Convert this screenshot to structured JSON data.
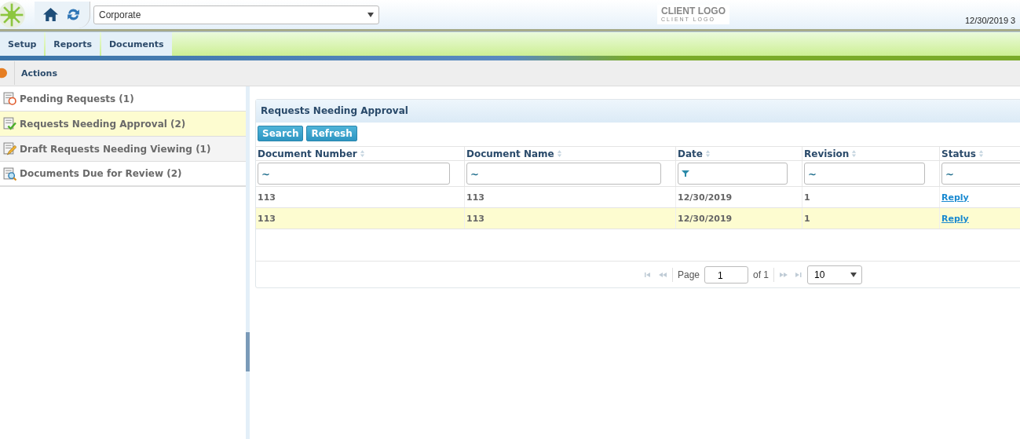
{
  "header": {
    "company": "Corporate",
    "logo": {
      "title": "CLIENT LOGO",
      "subtitle": "CLIENT LOGO"
    },
    "datetime": "12/30/2019 3"
  },
  "nav": [
    {
      "label": "Setup"
    },
    {
      "label": "Reports"
    },
    {
      "label": "Documents"
    }
  ],
  "breadcrumb": "Actions",
  "sidebar": {
    "items": [
      {
        "label": "Pending Requests (1)",
        "kind": "pending",
        "selected": false
      },
      {
        "label": "Requests Needing Approval (2)",
        "kind": "approval",
        "selected": true
      },
      {
        "label": "Draft Requests Needing Viewing (1)",
        "kind": "draft",
        "selected": false
      },
      {
        "label": "Documents Due for Review (2)",
        "kind": "review",
        "selected": false
      }
    ]
  },
  "panel": {
    "title": "Requests Needing Approval",
    "buttons": [
      "Search",
      "Refresh"
    ],
    "table": {
      "columns": [
        {
          "label": "Document Number",
          "filter": {
            "kind": "text",
            "value": "~"
          }
        },
        {
          "label": "Document Name",
          "filter": {
            "kind": "text",
            "value": "~"
          }
        },
        {
          "label": "Date",
          "filter": {
            "kind": "funnel"
          }
        },
        {
          "label": "Revision",
          "filter": {
            "kind": "text",
            "value": "~"
          }
        },
        {
          "label": "Status",
          "filter": {
            "kind": "text",
            "value": "~"
          }
        }
      ],
      "rows": [
        {
          "cells": [
            "113",
            "113",
            "12/30/2019",
            "1"
          ],
          "status": "Reply",
          "selected": false
        },
        {
          "cells": [
            "113",
            "113",
            "12/30/2019",
            "1"
          ],
          "status": "Reply",
          "selected": true
        }
      ]
    },
    "pager": {
      "label": "Page",
      "page": "1",
      "of": "of 1",
      "page_size": "10"
    }
  }
}
